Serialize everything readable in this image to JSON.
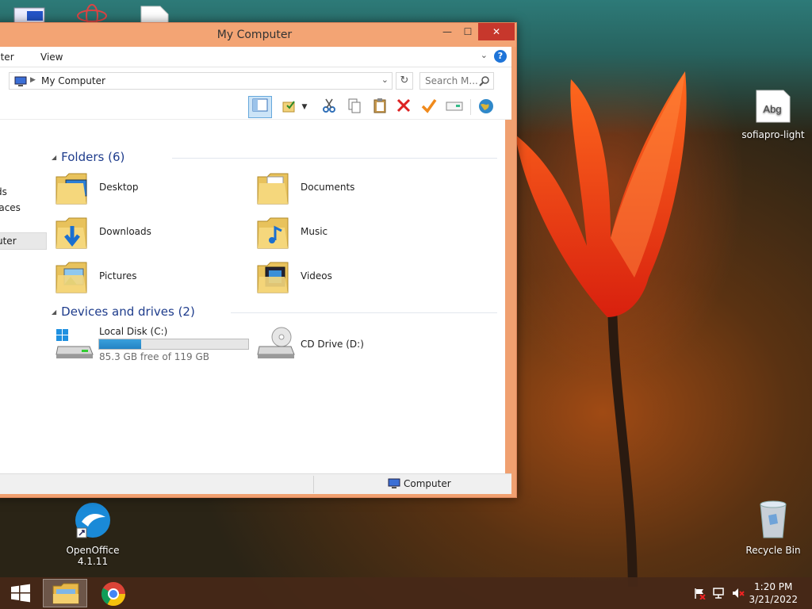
{
  "window": {
    "title": "My Computer",
    "min_glyph": "—",
    "max_glyph": "☐",
    "close_glyph": "✕",
    "menu": [
      "uter",
      "View"
    ],
    "help": "?",
    "address": "My Computer",
    "search_placeholder": "Search M...",
    "nav_items": [
      "ds",
      "laces",
      "uter"
    ],
    "groups": {
      "folders_title": "Folders (6)",
      "drives_title": "Devices and drives (2)"
    },
    "folders": [
      "Desktop",
      "Documents",
      "Downloads",
      "Music",
      "Pictures",
      "Videos"
    ],
    "drives": [
      {
        "name": "Local Disk (C:)",
        "free": "85.3 GB free of 119 GB",
        "used_fraction": 0.28
      },
      {
        "name": "CD Drive (D:)"
      }
    ],
    "status": "Computer"
  },
  "desktop": {
    "font_file": "sofiapro-light",
    "font_preview": "Abg",
    "openoffice": "OpenOffice 4.1.11",
    "recycle": "Recycle Bin"
  },
  "taskbar": {
    "time": "1:20 PM",
    "date": "3/21/2022"
  },
  "colors": {
    "titlebar": "#f3a474",
    "close": "#c7372c",
    "accent": "#1e3c8c",
    "progress": "#2383c4"
  }
}
